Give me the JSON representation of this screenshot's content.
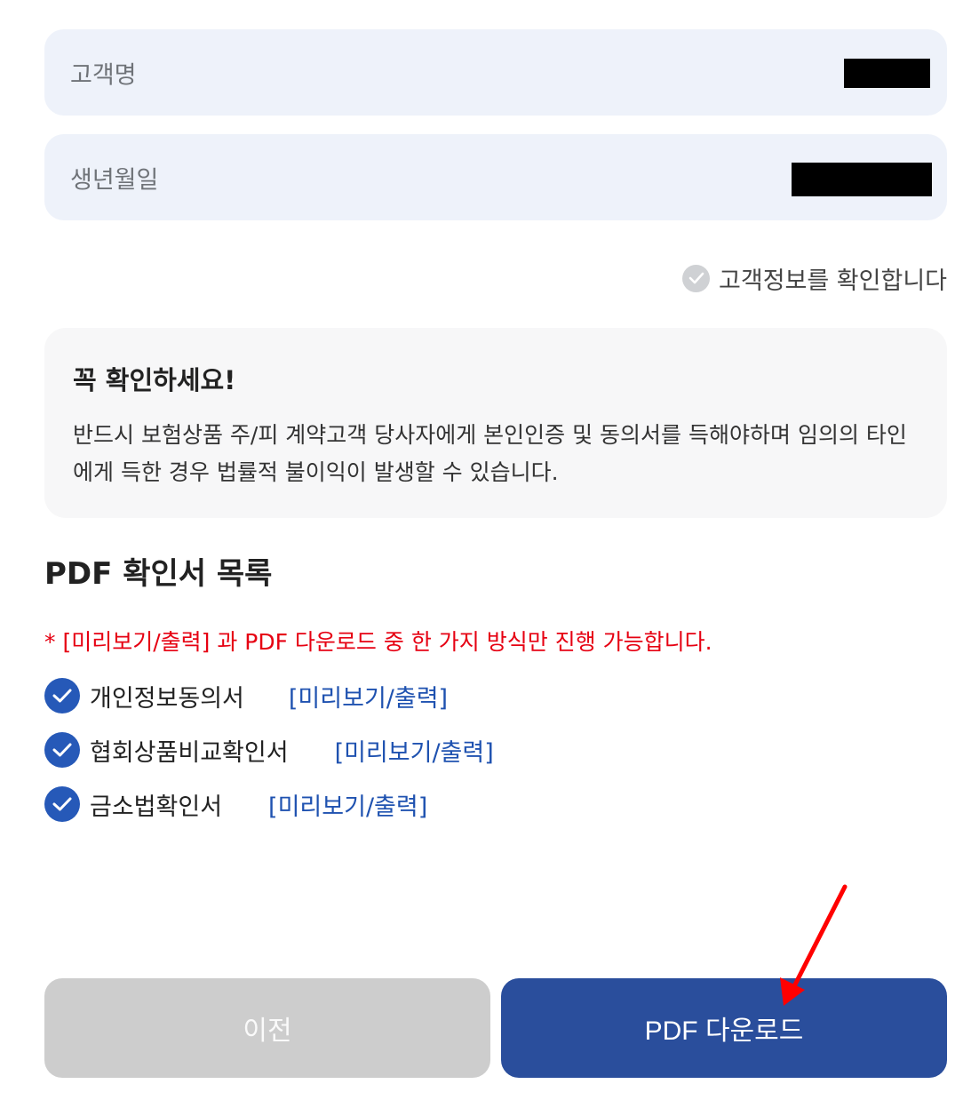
{
  "customer_info": {
    "name_label": "고객명",
    "birth_label": "생년월일",
    "confirm_text": "고객정보를 확인합니다"
  },
  "notice": {
    "title": "꼭 확인하세요!",
    "body": "반드시 보험상품 주/피 계약고객 당사자에게 본인인증 및 동의서를 득해야하며 임의의 타인에게 득한 경우 법률적 불이익이 발생할 수 있습니다."
  },
  "pdf_list": {
    "title": "PDF 확인서 목록",
    "warning": "* [미리보기/출력] 과 PDF 다운로드 중 한 가지 방식만 진행 가능합니다.",
    "items": [
      {
        "name": "개인정보동의서",
        "preview_label": "[미리보기/출력]",
        "checked": true
      },
      {
        "name": "협회상품비교확인서",
        "preview_label": "[미리보기/출력]",
        "checked": true
      },
      {
        "name": "금소법확인서",
        "preview_label": "[미리보기/출력]",
        "checked": true
      }
    ]
  },
  "buttons": {
    "prev_label": "이전",
    "pdf_download_label": "PDF 다운로드"
  },
  "colors": {
    "primary": "#2a4e9c",
    "check_blue": "#2659b8",
    "warning_red": "#e60012",
    "link_blue": "#1f52b0",
    "field_bg": "#eef2fa",
    "annotation_arrow": "#ff0000"
  }
}
